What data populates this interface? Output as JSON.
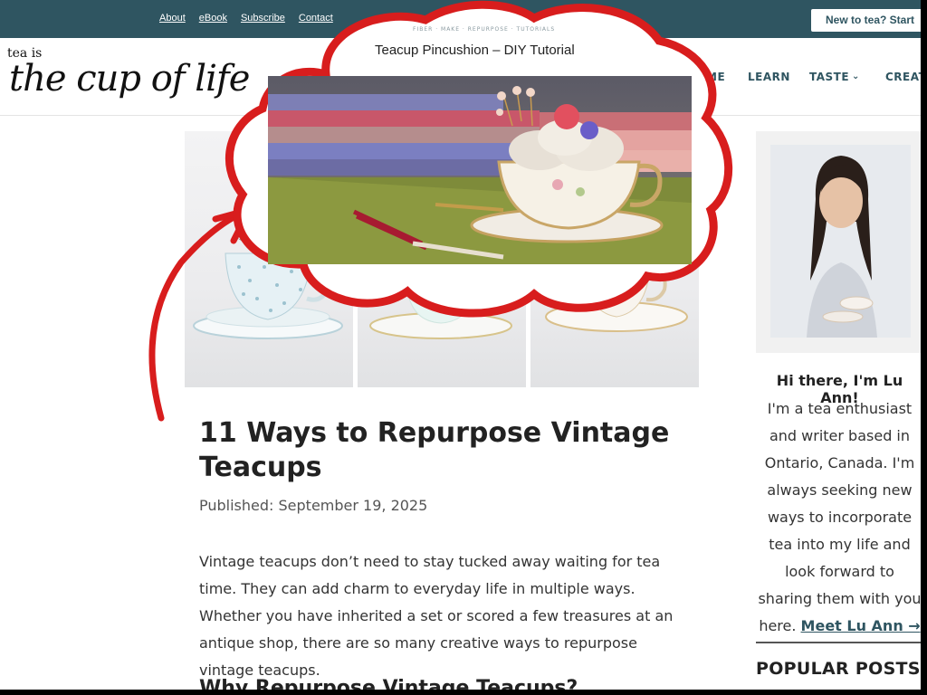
{
  "topbar": {
    "links": [
      "About",
      "eBook",
      "Subscribe",
      "Contact"
    ],
    "cta": "New to tea? Start",
    "bg": "#2f5561"
  },
  "header": {
    "logo_small": "tea is",
    "logo_big": "the cup of life",
    "nav": [
      "ME",
      "LEARN",
      "TASTE",
      "CREAT"
    ]
  },
  "overlay": {
    "tags": "FIBER · MAKE · REPURPOSE · TUTORIALS",
    "title": "Teacup Pincushion – DIY Tutorial",
    "accent": "#d81d1d"
  },
  "article": {
    "title": "11 Ways to Repurpose Vintage Teacups",
    "published": "Published: September 19, 2025",
    "intro": "Vintage teacups don’t need to stay tucked away waiting for tea time. They can add charm to everyday life in multiple ways. Whether you have inherited a set or scored a few treasures at an antique shop, there are so many creative ways to repurpose vintage teacups.",
    "subhead": "Why Repurpose Vintage Teacups?"
  },
  "sidebar": {
    "hello": "Hi there, I'm Lu Ann!",
    "bio": "I'm a tea enthusiast and writer based in Ontario, Canada. I'm always seeking new ways to incorporate tea into my life and look forward to sharing them with you here.",
    "meet_link": "Meet Lu Ann →",
    "popular": "POPULAR POSTS"
  }
}
